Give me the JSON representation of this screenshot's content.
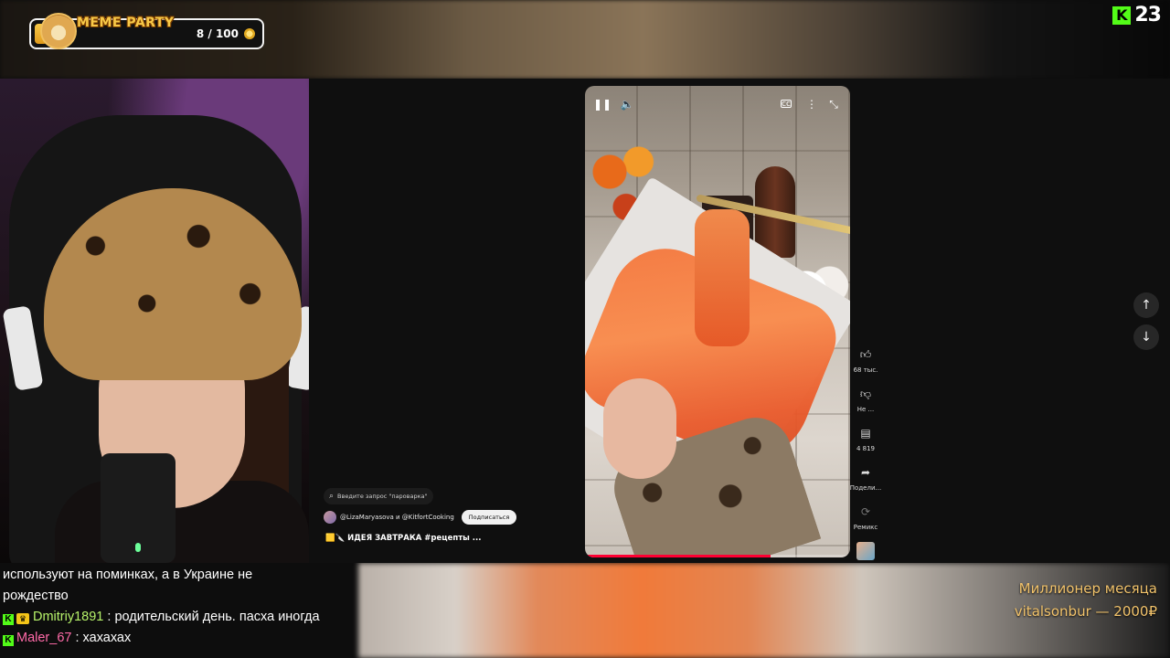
{
  "widget": {
    "title": "MEME PARTY",
    "count": "8 / 100"
  },
  "kick": {
    "logo": "K",
    "number": "23"
  },
  "shorts": {
    "search_placeholder": "Введите запрос \"пароварка\"",
    "channel": "@LizaMaryasova и @KitfortCooking",
    "subscribe_label": "Подписаться",
    "title": "🟨🔪 ИДЕЯ ЗАВТРАКА #рецепты ...",
    "progress": 0.7,
    "actions": {
      "like_count": "68 тыс.",
      "dislike_label": "Не ...",
      "comments_count": "4 819",
      "share_label": "Подели...",
      "remix_label": "Ремикс"
    }
  },
  "chat": [
    {
      "text": "используют на поминках, а в Украине не"
    },
    {
      "text": "рождество"
    },
    {
      "user": "Dmitriy1891",
      "message": " : родительский день. пасха иногда"
    },
    {
      "user": "Maler_67",
      "message": " : хахахах"
    }
  ],
  "million": {
    "title": "Миллионер месяца",
    "line": "vitalsonbur — 2000₽"
  },
  "icons": {
    "pause": "pause-icon",
    "volume": "volume-icon",
    "captions": "captions-icon",
    "more": "more-vertical-icon",
    "collapse": "collapse-icon",
    "like": "thumb-up-icon",
    "dislike": "thumb-down-icon",
    "comments": "comment-icon",
    "share": "share-icon",
    "remix": "remix-icon",
    "up": "arrow-up-icon",
    "down": "arrow-down-icon"
  },
  "colors": {
    "kick_green": "#53fc18",
    "accent_gold": "#f2c36b",
    "progress_red": "#ff0033"
  }
}
